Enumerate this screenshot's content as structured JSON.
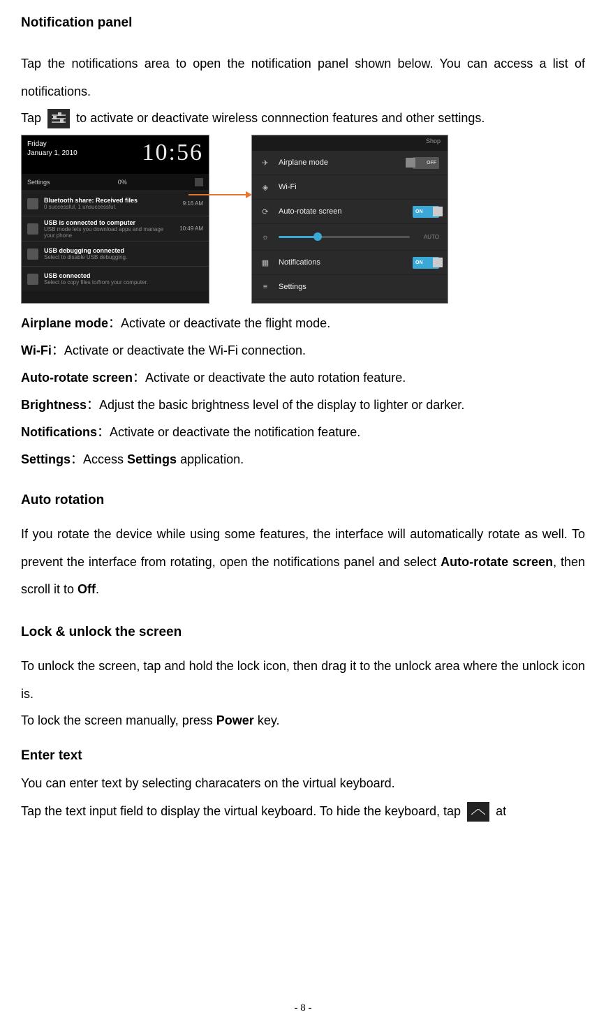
{
  "heading1": "Notification panel",
  "para1": "Tap the notifications area to open the notification panel shown below. You can access a list of notifications.",
  "tap_prefix": "Tap",
  "tap_suffix": " to activate or deactivate wireless connnection features and other settings.",
  "shot1": {
    "day": "Friday",
    "date": "January 1, 2010",
    "time": "10:56",
    "status_left": "Settings",
    "status_right": "0%",
    "notifs": [
      {
        "title": "Bluetooth share: Received files",
        "sub": "0 successful, 1 unsuccessful.",
        "time": "9:16 AM"
      },
      {
        "title": "USB is connected to computer",
        "sub": "USB mode lets you download apps and manage your phone",
        "time": "10:49 AM"
      },
      {
        "title": "USB debugging connected",
        "sub": "Select to disable USB debugging.",
        "time": ""
      },
      {
        "title": "USB connected",
        "sub": "Select to copy files to/from your computer.",
        "time": ""
      }
    ]
  },
  "shot2": {
    "topbar": "Shop",
    "rows": {
      "airplane": "Airplane mode",
      "airplane_toggle": "OFF",
      "wifi": "Wi-Fi",
      "autorotate": "Auto-rotate screen",
      "autorotate_toggle": "ON",
      "brightness_auto": "AUTO",
      "notifications": "Notifications",
      "notifications_toggle": "ON",
      "settings": "Settings"
    }
  },
  "defs": {
    "airplane_t": "Airplane mode",
    "airplane_d": "：Activate or deactivate the flight mode.",
    "wifi_t": "Wi-Fi",
    "wifi_d": "：Activate or deactivate the Wi-Fi connection.",
    "autorotate_t": "Auto-rotate screen",
    "autorotate_d": "：Activate or deactivate the auto rotation feature.",
    "brightness_t": "Brightness",
    "brightness_d": "：Adjust the basic brightness level of the display to lighter or darker.",
    "notifications_t": "Notifications",
    "notifications_d": "：Activate or deactivate the notification feature.",
    "settings_t": "Settings",
    "settings_d1": "：Access ",
    "settings_d2": "Settings",
    "settings_d3": " application."
  },
  "heading2": "Auto rotation",
  "para2_a": "If you rotate the device while using some features, the interface will automatically rotate as well. To prevent the interface from rotating, open the notifications panel and select ",
  "para2_b": "Auto-rotate screen",
  "para2_c": ", then scroll it to ",
  "para2_d": "Off",
  "para2_e": ".",
  "heading3": "Lock & unlock the screen",
  "para3": "To unlock the screen, tap and hold the lock icon, then drag it to the unlock area where the unlock icon is.",
  "para3b_a": "To lock the screen manually, press ",
  "para3b_b": "Power",
  "para3b_c": " key.",
  "heading4": "Enter text",
  "para4": "You can enter text by selecting characaters on the virtual keyboard.",
  "para5_a": "Tap the text input field to display the virtual keyboard. To hide the keyboard, tap ",
  "para5_b": " at",
  "pagenum": "- 8 -"
}
